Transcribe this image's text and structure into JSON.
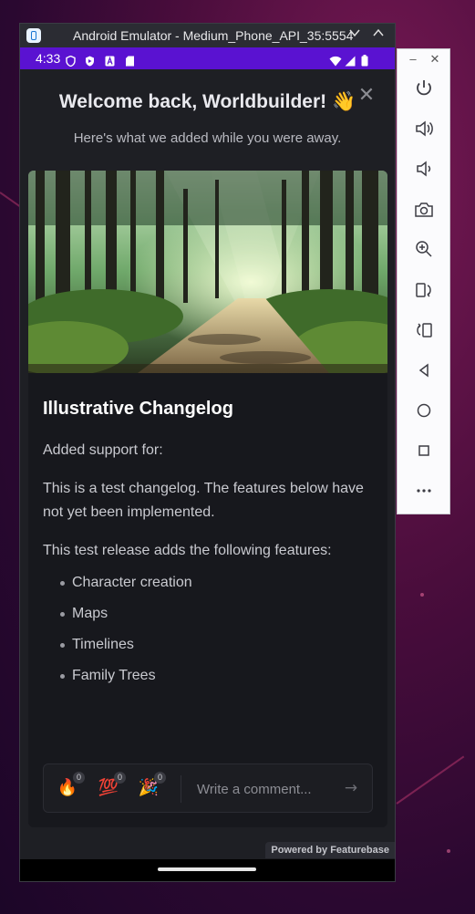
{
  "emulator": {
    "window_title": "Android Emulator - Medium_Phone_API_35:5554",
    "status_time": "4:33"
  },
  "modal": {
    "heading": "Welcome back, Worldbuilder! 👋",
    "subheading": "Here's what we added while you were away.",
    "changelog": {
      "title": "Illustrative Changelog",
      "intro": "Added support for:",
      "note": "This is a test changelog. The features below have not yet been implemented.",
      "lead": "This test release adds the following features:",
      "features": [
        "Character creation",
        "Maps",
        "Timelines",
        "Family Trees"
      ]
    },
    "reactions": [
      {
        "emoji": "🔥",
        "count": "0"
      },
      {
        "emoji": "💯",
        "count": "0"
      },
      {
        "emoji": "🎉",
        "count": "0"
      }
    ],
    "comment_placeholder": "Write a comment...",
    "powered_by": "Powered by Featurebase"
  },
  "side_toolbar": {
    "buttons": [
      "power-icon",
      "volume-up-icon",
      "volume-down-icon",
      "camera-icon",
      "zoom-icon",
      "rotate-left-icon",
      "rotate-right-icon",
      "back-icon",
      "home-icon",
      "overview-icon",
      "more-icon"
    ]
  },
  "colors": {
    "status_bar": "#5a12d1",
    "modal_bg": "#1e1f24",
    "card_bg": "#17181d"
  }
}
